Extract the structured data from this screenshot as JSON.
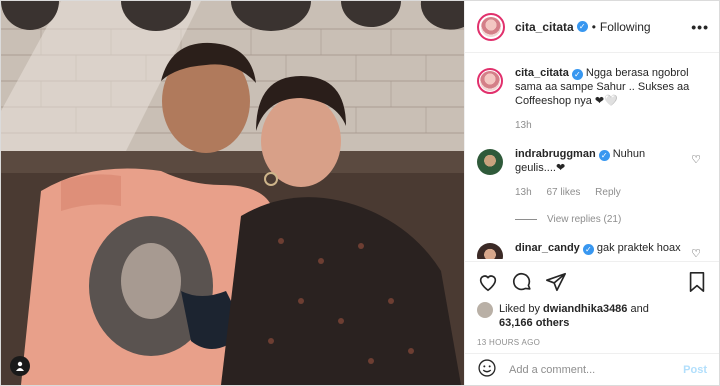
{
  "header": {
    "username": "cita_citata",
    "separator": "•",
    "follow_status": "Following",
    "more": "•••"
  },
  "caption": {
    "username": "cita_citata",
    "text": "Ngga berasa ngobrol sama aa sampe Sahur .. Sukses aa Coffeeshop nya ❤︎🤍",
    "time": "13h"
  },
  "comments": [
    {
      "username": "indrabruggman",
      "text": "Nuhun geulis....❤︎",
      "time": "13h",
      "likes": "67 likes",
      "reply": "Reply",
      "view_replies": "View replies (21)"
    },
    {
      "username": "dinar_candy",
      "text": "gak praktek hoax"
    }
  ],
  "actions": {
    "liked_by_prefix": "Liked by",
    "liked_by_user": "dwiandhika3486",
    "liked_by_and": "and",
    "liked_by_others": "63,166 others",
    "timestamp": "13 HOURS AGO"
  },
  "add_comment": {
    "placeholder": "Add a comment...",
    "post_label": "Post"
  },
  "colors": {
    "verified": "#3897f0",
    "post_disabled": "#b2dffc",
    "meta_gray": "#8e8e8e"
  }
}
